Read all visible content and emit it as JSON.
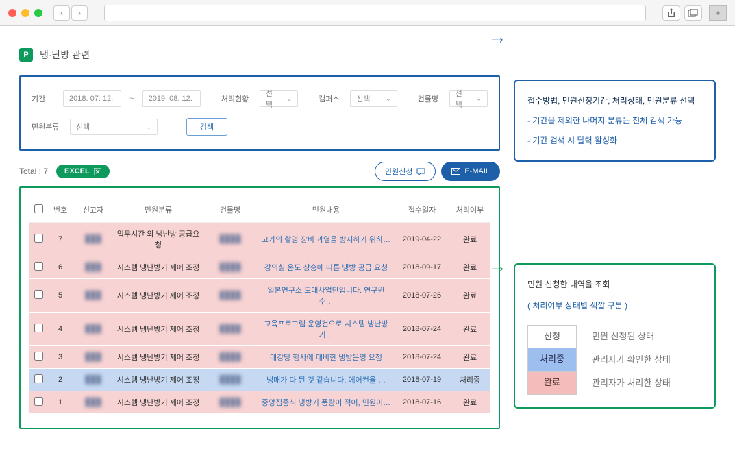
{
  "page": {
    "title": "냉·난방 관련"
  },
  "filter": {
    "period_label": "기간",
    "date_from": "2018. 07. 12.",
    "date_to": "2019. 08. 12.",
    "status_label": "처리현황",
    "status_value": "선택",
    "campus_label": "캠퍼스",
    "campus_value": "선택",
    "building_label": "건물명",
    "building_value": "선택",
    "category_label": "민원분류",
    "category_value": "선택",
    "search_btn": "검색"
  },
  "totals": {
    "prefix": "Total : ",
    "count": "7",
    "excel_btn": "EXCEL",
    "apply_btn": "민원신청",
    "email_btn": "E-MAIL"
  },
  "table": {
    "headers": {
      "no": "번호",
      "reporter": "신고자",
      "category": "민원분류",
      "building": "건물명",
      "content": "민원내용",
      "date": "접수일자",
      "status": "처리여부"
    },
    "rows": [
      {
        "no": "7",
        "category": "업무시간 외 냉난방 공급요청",
        "content": "고가의 촬영 장비 과열을 방지하기 위하…",
        "date": "2019-04-22",
        "status": "완료",
        "statusClass": "row-done"
      },
      {
        "no": "6",
        "category": "시스템 냉난방기 제어 조정",
        "content": "강의실 온도 상승에 따른 냉방 공급 요청",
        "date": "2018-09-17",
        "status": "완료",
        "statusClass": "row-done"
      },
      {
        "no": "5",
        "category": "시스템 냉난방기 제어 조정",
        "content": "일본연구소 토대사업단입니다. 연구원 수…",
        "date": "2018-07-26",
        "status": "완료",
        "statusClass": "row-done"
      },
      {
        "no": "4",
        "category": "시스템 냉난방기 제어 조정",
        "content": "교육프로그램 운영건으로 시스템 냉난방기…",
        "date": "2018-07-24",
        "status": "완료",
        "statusClass": "row-done"
      },
      {
        "no": "3",
        "category": "시스템 냉난방기 제어 조정",
        "content": "대강당 행사에 대비한 냉방운영 요청",
        "date": "2018-07-24",
        "status": "완료",
        "statusClass": "row-done"
      },
      {
        "no": "2",
        "category": "시스템 냉난방기 제어 조정",
        "content": "냉매가 다 된 것 같습니다. 에어컨을 …",
        "date": "2018-07-19",
        "status": "처리중",
        "statusClass": "row-processing"
      },
      {
        "no": "1",
        "category": "시스템 냉난방기 제어 조정",
        "content": "중앙집중식 냉방기 풍량이 적어, 민원이…",
        "date": "2018-07-16",
        "status": "완료",
        "statusClass": "row-done"
      }
    ]
  },
  "anno1": {
    "line1": "접수방법, 민원신청기간, 처리상태, 민원분류 선택",
    "line2": "- 기간을 제외한 나머지 분류는 전체 검색 가능",
    "line3": "- 기간 검색 시 달력 활성화"
  },
  "anno2": {
    "title": "민원 신청한 내역을 조회",
    "subtitle": "( 처리여부 상태별 색깔 구분 )",
    "legend": [
      {
        "chip": "신청",
        "desc": "민원 신청된 상태",
        "cls": "chip-new"
      },
      {
        "chip": "처리중",
        "desc": "관리자가 확인한 상태",
        "cls": "chip-proc"
      },
      {
        "chip": "완료",
        "desc": "관리자가 처리한 상태",
        "cls": "chip-done"
      }
    ]
  }
}
